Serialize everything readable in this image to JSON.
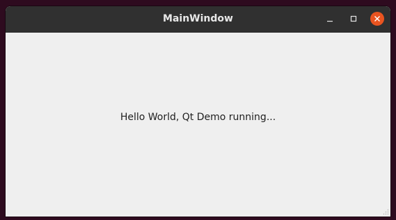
{
  "window": {
    "title": "MainWindow",
    "controls": {
      "minimize_icon": "minimize-icon",
      "maximize_icon": "maximize-icon",
      "close_icon": "close-icon"
    }
  },
  "content": {
    "message": "Hello World, Qt Demo running..."
  },
  "colors": {
    "titlebar": "#303030",
    "close_button": "#e95420",
    "content_background": "#efefef",
    "desktop": "#2e0b1f"
  }
}
